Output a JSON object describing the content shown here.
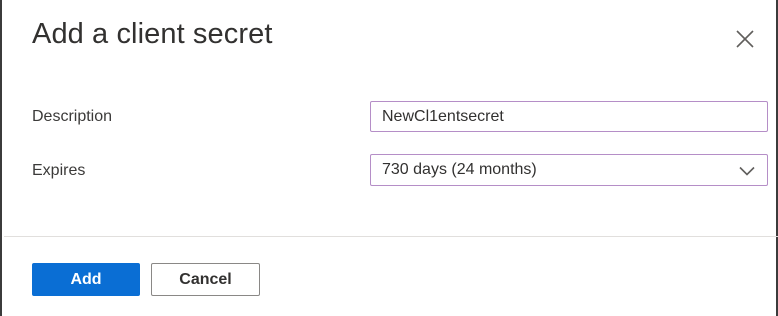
{
  "dialog": {
    "title": "Add a client secret",
    "close_icon": "close-icon"
  },
  "form": {
    "description": {
      "label": "Description",
      "value": "NewCl1entsecret"
    },
    "expires": {
      "label": "Expires",
      "selected": "730 days (24 months)",
      "icon": "chevron-down-icon"
    }
  },
  "footer": {
    "add_label": "Add",
    "cancel_label": "Cancel"
  },
  "colors": {
    "primary": "#0a6ed4",
    "field_border": "#b58ec7",
    "text": "#323130"
  }
}
